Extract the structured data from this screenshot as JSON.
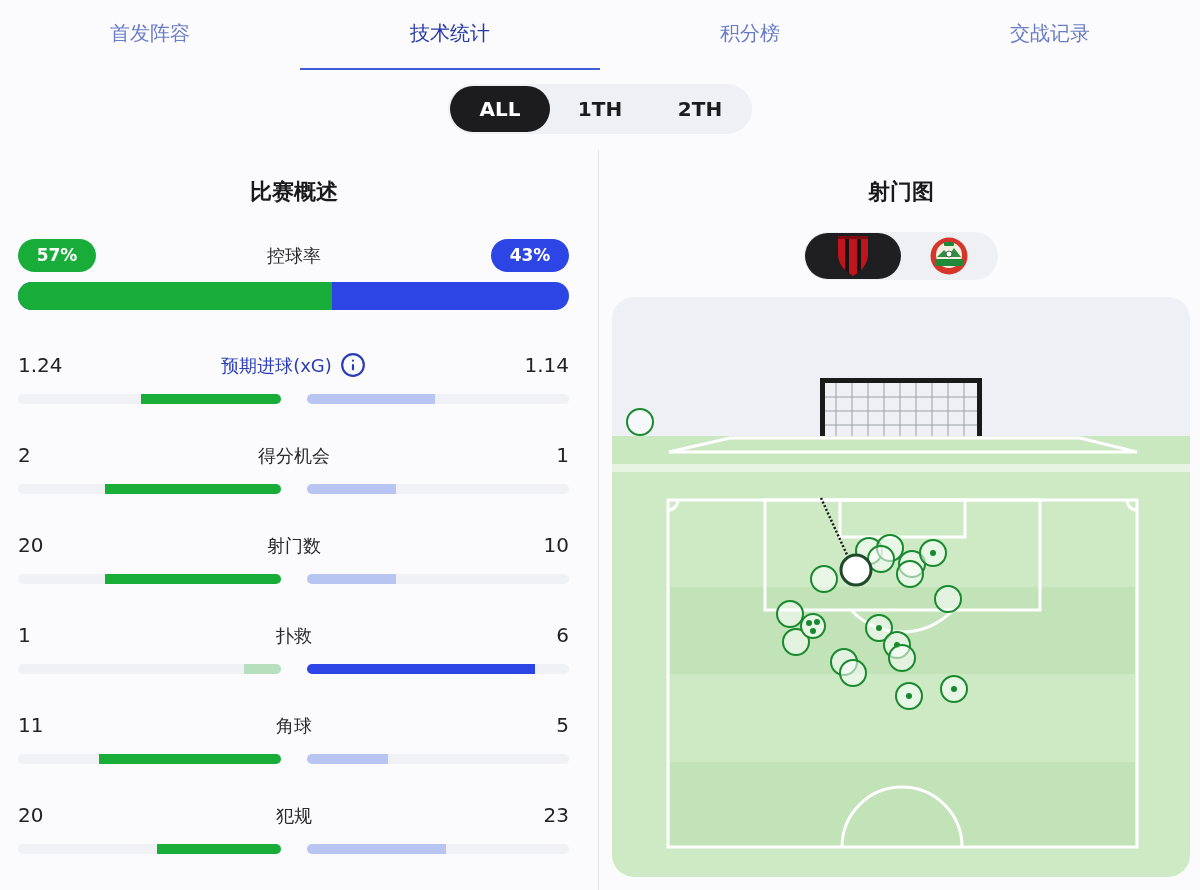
{
  "tabs": [
    {
      "label": "首发阵容",
      "selected": false
    },
    {
      "label": "技术统计",
      "selected": true
    },
    {
      "label": "积分榜",
      "selected": false
    },
    {
      "label": "交战记录",
      "selected": false
    }
  ],
  "periods": [
    {
      "label": "ALL",
      "selected": true
    },
    {
      "label": "1TH",
      "selected": false
    },
    {
      "label": "2TH",
      "selected": false
    }
  ],
  "match_overview": {
    "title": "比赛概述",
    "possession": {
      "label": "控球率",
      "home": "57%",
      "away": "43%",
      "level": 0.57
    },
    "stats": [
      {
        "kind": "info",
        "label": "预期进球(xG)",
        "home": "1.24",
        "away": "1.14",
        "home_bar": {
          "level": 0.53,
          "highlighted": true
        },
        "away_bar": {
          "level": 0.49,
          "highlighted": false
        }
      },
      {
        "kind": "plain",
        "label": "得分机会",
        "home": "2",
        "away": "1",
        "home_bar": {
          "level": 0.67,
          "highlighted": true
        },
        "away_bar": {
          "level": 0.34,
          "highlighted": false
        }
      },
      {
        "kind": "plain",
        "label": "射门数",
        "home": "20",
        "away": "10",
        "home_bar": {
          "level": 0.67,
          "highlighted": true
        },
        "away_bar": {
          "level": 0.34,
          "highlighted": false
        }
      },
      {
        "kind": "plain",
        "label": "扑救",
        "home": "1",
        "away": "6",
        "home_bar": {
          "level": 0.14,
          "highlighted": false
        },
        "away_bar": {
          "level": 0.87,
          "highlighted": true
        }
      },
      {
        "kind": "plain",
        "label": "角球",
        "home": "11",
        "away": "5",
        "home_bar": {
          "level": 0.69,
          "highlighted": true
        },
        "away_bar": {
          "level": 0.31,
          "highlighted": false
        }
      },
      {
        "kind": "plain",
        "label": "犯规",
        "home": "20",
        "away": "23",
        "home_bar": {
          "level": 0.47,
          "highlighted": true
        },
        "away_bar": {
          "level": 0.53,
          "highlighted": false
        }
      }
    ]
  },
  "shot_map": {
    "title": "射门图",
    "teams": [
      {
        "kind": "shield",
        "selected": true
      },
      {
        "kind": "round",
        "selected": false
      }
    ]
  }
}
